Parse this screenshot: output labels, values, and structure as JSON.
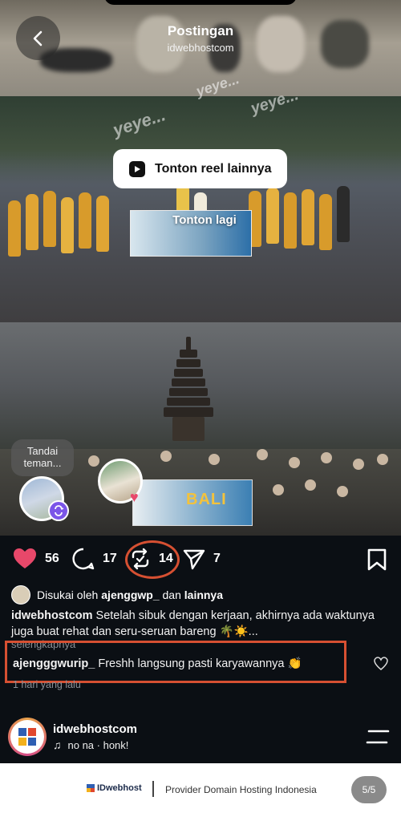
{
  "header": {
    "title": "Postingan",
    "subtitle": "idwebhostcom"
  },
  "media": {
    "watermark": [
      "yeye...",
      "yeye...",
      "yeye..."
    ],
    "reel_button_label": "Tonton reel lainnya",
    "replay_label": "Tonton lagi",
    "tag_people_label": "Tandai teman...",
    "banner_text": "BALI"
  },
  "actions": {
    "likes": "56",
    "comments": "17",
    "reposts": "14",
    "shares": "7"
  },
  "liked_by": {
    "prefix": "Disukai oleh ",
    "user": "ajenggwp_",
    "middle": " dan ",
    "others": "lainnya"
  },
  "caption": {
    "user": "idwebhostcom",
    "text": " Setelah sibuk dengan kerjaan, akhirnya ada waktunya juga buat rehat dan seru-seruan bareng 🌴☀️...",
    "more": "selengkapnya"
  },
  "comment": {
    "user": "ajengggwurip_",
    "text": " Freshh langsung pasti karyawannya 👏"
  },
  "time_ago": "1 hari yang lalu",
  "profile": {
    "name": "idwebhostcom",
    "music": "no na · honk!"
  },
  "footer": {
    "logo": "IDwebhost",
    "tagline": "Provider Domain Hosting Indonesia",
    "page": "5/5"
  },
  "colors": {
    "highlight": "#d65032",
    "like": "#e8486a",
    "accent": "#7b55e8"
  }
}
